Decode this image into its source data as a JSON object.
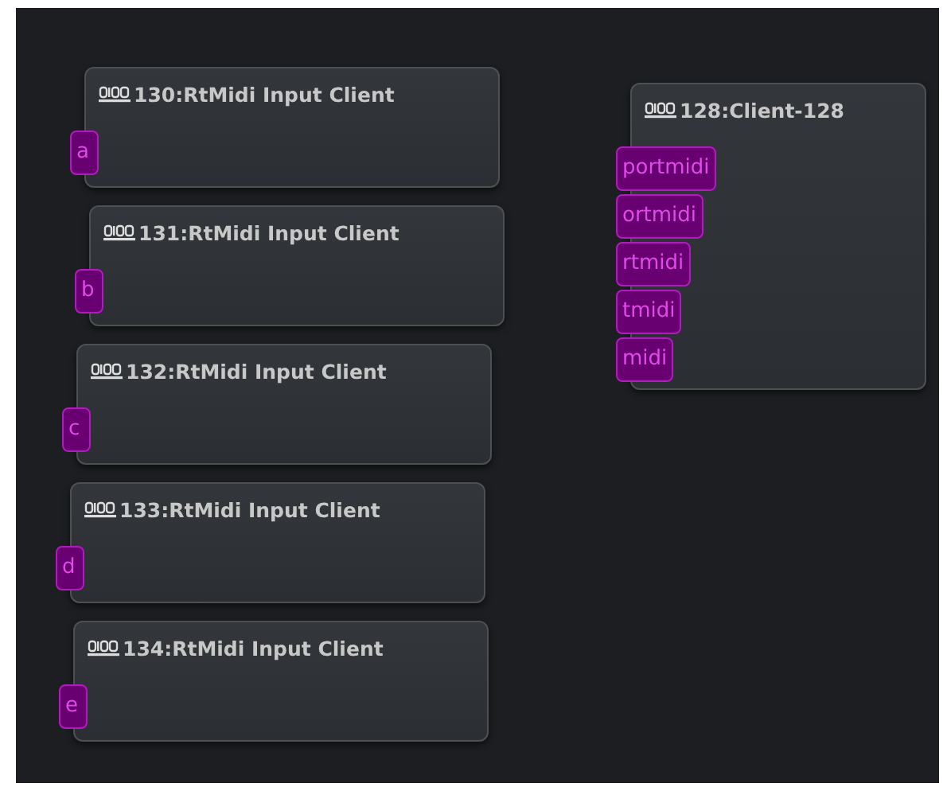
{
  "nodes": [
    {
      "title": "130:RtMidi Input Client",
      "ports": [
        "a"
      ]
    },
    {
      "title": "131:RtMidi Input Client",
      "ports": [
        "b"
      ]
    },
    {
      "title": "132:RtMidi Input Client",
      "ports": [
        "c"
      ]
    },
    {
      "title": "133:RtMidi Input Client",
      "ports": [
        "d"
      ]
    },
    {
      "title": "134:RtMidi Input Client",
      "ports": [
        "e"
      ]
    },
    {
      "title": "128:Client-128",
      "ports": [
        "portmidi",
        "ortmidi",
        "rtmidi",
        "tmidi",
        "midi"
      ]
    }
  ]
}
